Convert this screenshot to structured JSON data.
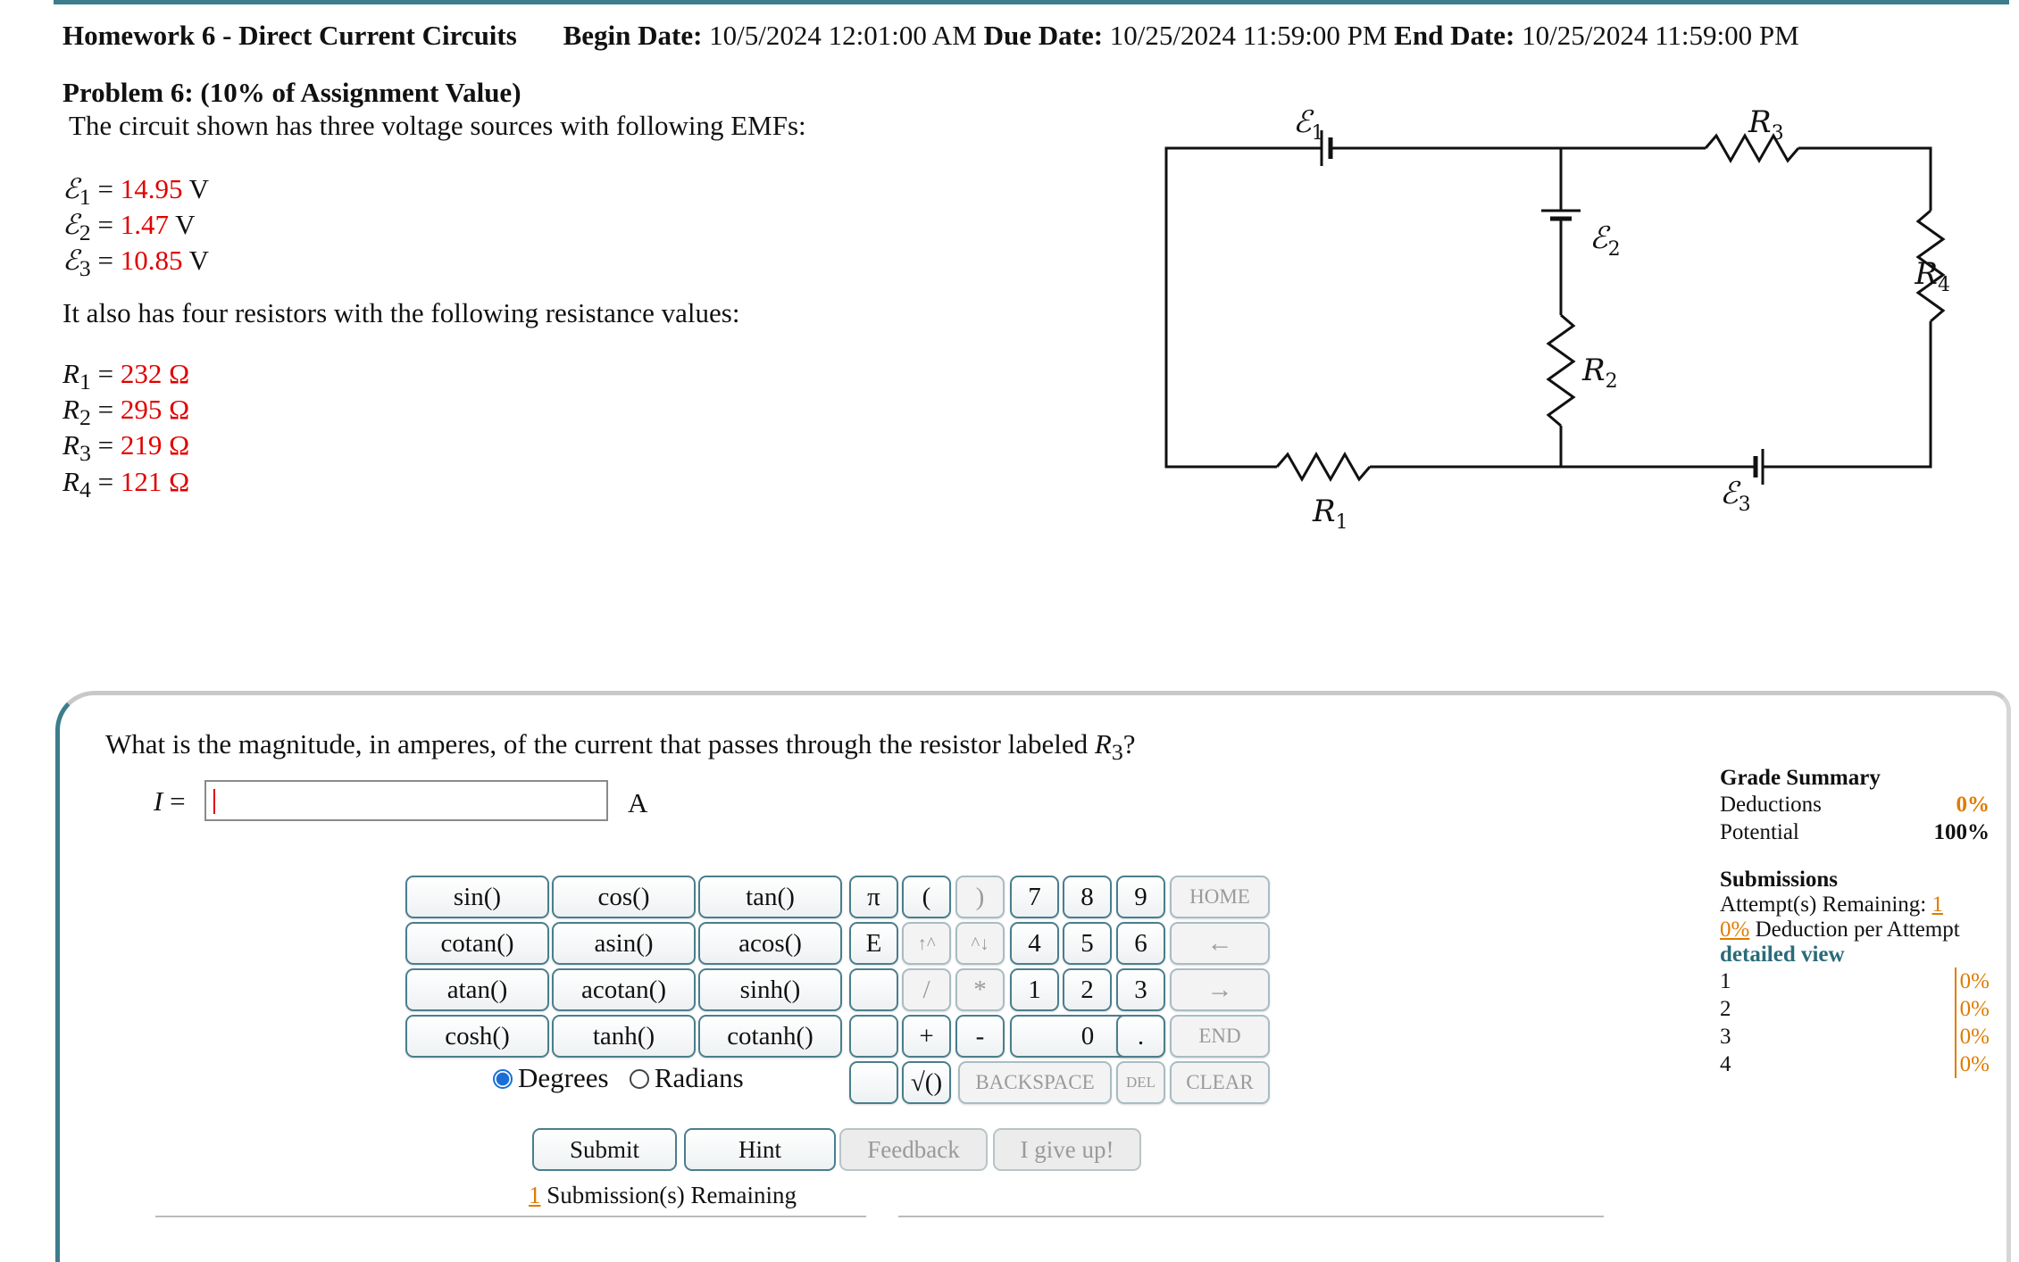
{
  "header": {
    "assignment": "Homework 6 - Direct Current Circuits",
    "begin_label": "Begin Date:",
    "begin_value": "10/5/2024 12:01:00 AM",
    "due_label": "Due Date:",
    "due_value": "10/25/2024 11:59:00 PM",
    "end_label": "End Date:",
    "end_value": "10/25/2024 11:59:00 PM"
  },
  "problem": {
    "title": "Problem 6: (10% of Assignment Value)",
    "intro": "The circuit shown has three voltage sources with following EMFs:",
    "emfs": [
      {
        "sym": "ℰ",
        "sub": "1",
        "value": "14.95",
        "unit": "V"
      },
      {
        "sym": "ℰ",
        "sub": "2",
        "value": "1.47",
        "unit": "V"
      },
      {
        "sym": "ℰ",
        "sub": "3",
        "value": "10.85",
        "unit": "V"
      }
    ],
    "resist_intro": "It also has four resistors with the following resistance values:",
    "resistors": [
      {
        "sym": "R",
        "sub": "1",
        "value": "232",
        "unit": "Ω"
      },
      {
        "sym": "R",
        "sub": "2",
        "value": "295",
        "unit": "Ω"
      },
      {
        "sym": "R",
        "sub": "3",
        "value": "219",
        "unit": "Ω"
      },
      {
        "sym": "R",
        "sub": "4",
        "value": "121",
        "unit": "Ω"
      }
    ]
  },
  "circuit_labels": {
    "e1": "ℰ",
    "e1_sub": "1",
    "e2": "ℰ",
    "e2_sub": "2",
    "e3": "ℰ",
    "e3_sub": "3",
    "r1": "R",
    "r1_sub": "1",
    "r2": "R",
    "r2_sub": "2",
    "r3": "R",
    "r3_sub": "3",
    "r4": "R",
    "r4_sub": "4"
  },
  "question": {
    "text": "What is the magnitude, in amperes, of the current that passes through the resistor labeled",
    "target_sym": "R",
    "target_sub": "3",
    "end": "?",
    "answer_label": "I =",
    "answer_value": "",
    "unit": "A"
  },
  "keypad": {
    "functions": [
      "sin()",
      "cos()",
      "tan()",
      "cotan()",
      "asin()",
      "acos()",
      "atan()",
      "acotan()",
      "sinh()",
      "cosh()",
      "tanh()",
      "cotanh()"
    ],
    "pi": "π",
    "lparen": "(",
    "rparen": ")",
    "e": "E",
    "up": "↑^",
    "down": "^↓",
    "slash": "/",
    "star": "*",
    "plus": "+",
    "minus": "-",
    "sqrt": "√()",
    "digits": [
      "7",
      "8",
      "9",
      "4",
      "5",
      "6",
      "1",
      "2",
      "3",
      "0",
      "."
    ],
    "home": "HOME",
    "left": "←",
    "right": "→",
    "end": "END",
    "backspace": "BACKSPACE",
    "del": "DEL",
    "clear": "CLEAR"
  },
  "angle_mode": {
    "degrees": "Degrees",
    "radians": "Radians",
    "selected": "Degrees"
  },
  "actions": {
    "submit": "Submit",
    "hint": "Hint",
    "feedback": "Feedback",
    "give_up": "I give up!"
  },
  "submissions_remaining": {
    "count": "1",
    "text": "Submission(s) Remaining"
  },
  "grade_summary": {
    "title": "Grade Summary",
    "deductions_label": "Deductions",
    "deductions_value": "0%",
    "potential_label": "Potential",
    "potential_value": "100%",
    "submissions_title": "Submissions",
    "attempts_label": "Attempt(s) Remaining:",
    "attempts_value": "1",
    "deduction_pct": "0%",
    "deduction_text": "Deduction per Attempt",
    "detailed_view": "detailed view",
    "attempts": [
      {
        "n": "1",
        "pct": "0%"
      },
      {
        "n": "2",
        "pct": "0%"
      },
      {
        "n": "3",
        "pct": "0%"
      },
      {
        "n": "4",
        "pct": "0%"
      }
    ]
  },
  "colors": {
    "accent": "#3c7d8c",
    "value_red": "#e00000",
    "orange": "#e07b00"
  }
}
